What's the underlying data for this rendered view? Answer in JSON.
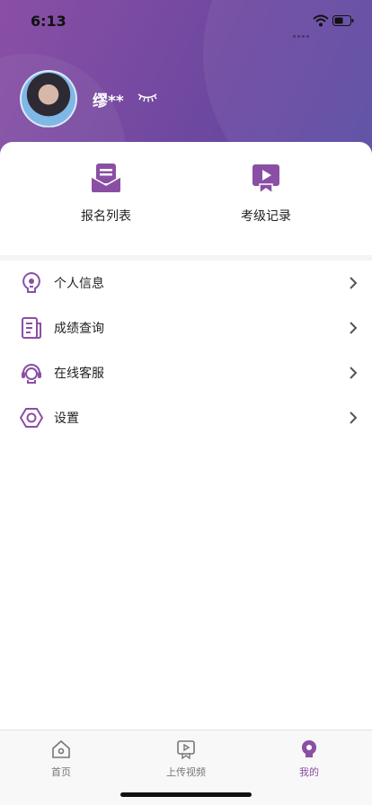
{
  "status_bar": {
    "time": "6:13"
  },
  "profile": {
    "username": "缪**"
  },
  "quick_actions": [
    {
      "label": "报名列表",
      "icon": "envelope-icon"
    },
    {
      "label": "考级记录",
      "icon": "video-record-icon"
    }
  ],
  "menu": [
    {
      "label": "个人信息",
      "icon": "person-bulb-icon"
    },
    {
      "label": "成绩查询",
      "icon": "document-icon"
    },
    {
      "label": "在线客服",
      "icon": "headset-icon"
    },
    {
      "label": "设置",
      "icon": "hexagon-settings-icon"
    }
  ],
  "tabbar": [
    {
      "label": "首页",
      "icon": "home-icon",
      "active": false
    },
    {
      "label": "上传视频",
      "icon": "upload-video-icon",
      "active": false
    },
    {
      "label": "我的",
      "icon": "profile-icon",
      "active": true
    }
  ],
  "colors": {
    "accent": "#8a4fa5",
    "header_start": "#8a4fa5",
    "header_end": "#574aa3"
  }
}
